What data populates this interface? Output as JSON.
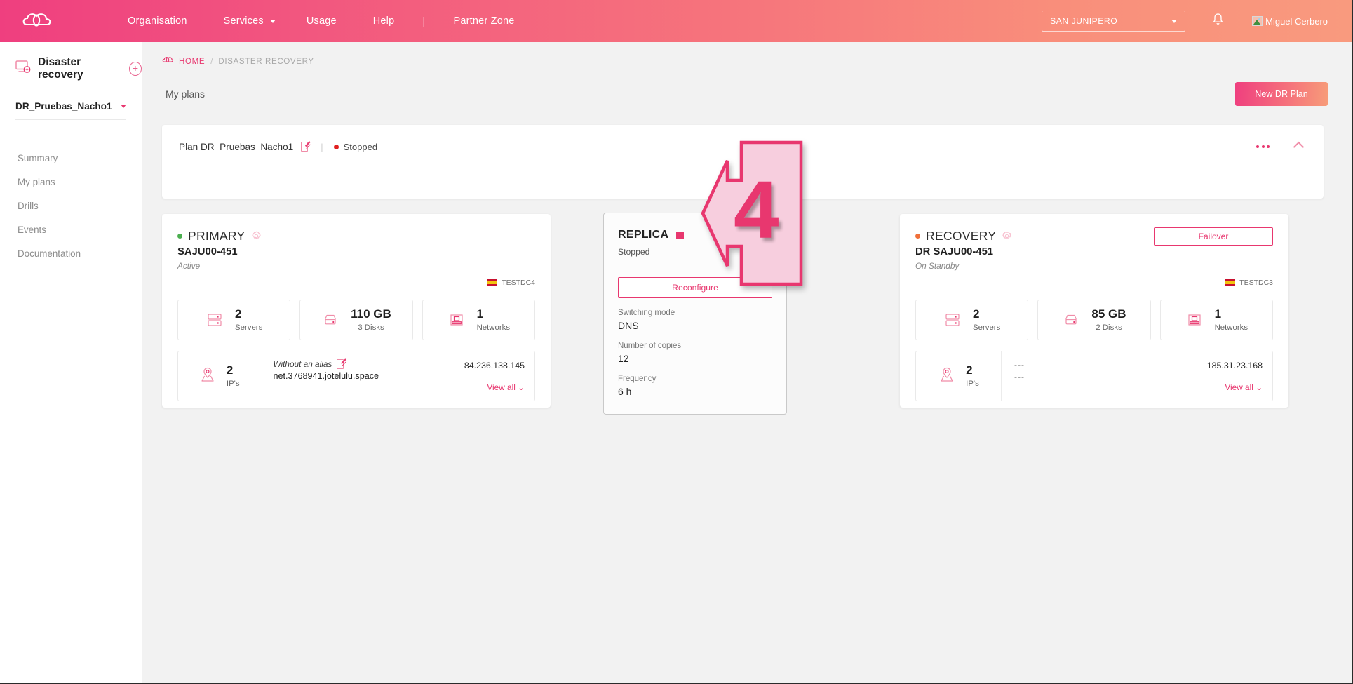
{
  "topnav": {
    "logo_icon": "cloud-logo-icon",
    "links": [
      {
        "label": "Organisation",
        "caret": false
      },
      {
        "label": "Services",
        "caret": true
      },
      {
        "label": "Usage",
        "caret": false
      },
      {
        "label": "Help",
        "caret": false
      }
    ],
    "separator": "|",
    "partner_zone": "Partner Zone",
    "org_selector": "SAN JUNIPERO",
    "bell_icon": "notification-bell-icon",
    "user_name": "Miguel Cerbero"
  },
  "sidebar": {
    "title": "Disaster recovery",
    "title_icon": "disaster-recovery-icon",
    "add_label": "+",
    "plan_selector": "DR_Pruebas_Nacho1",
    "items": [
      {
        "label": "Summary"
      },
      {
        "label": "My plans"
      },
      {
        "label": "Drills"
      },
      {
        "label": "Events"
      },
      {
        "label": "Documentation"
      }
    ]
  },
  "breadcrumb": {
    "home": "HOME",
    "separator": "/",
    "current": "DISASTER RECOVERY"
  },
  "page": {
    "title": "My plans",
    "new_plan_button": "New DR Plan"
  },
  "plan": {
    "title": "Plan DR_Pruebas_Nacho1",
    "divider": "|",
    "status": "Stopped",
    "status_color": "#e02020",
    "more_menu": "•••",
    "collapse": "chevron-up"
  },
  "primary": {
    "role": "PRIMARY",
    "status_dot_color": "#4caf50",
    "host": "SAJU00-451",
    "state": "Active",
    "datacenter": "TESTDC4",
    "stats": [
      {
        "icon": "server-icon",
        "value": "2",
        "label": "Servers"
      },
      {
        "icon": "disk-icon",
        "value": "110 GB",
        "label": "3 Disks"
      },
      {
        "icon": "network-icon",
        "value": "1",
        "label": "Networks"
      }
    ],
    "ip": {
      "icon": "location-pin-icon",
      "count": "2",
      "count_label": "IP's",
      "alias": "Without an alias",
      "alias_edit_icon": "edit-icon",
      "hostname": "net.3768941.jotelulu.space",
      "address": "84.236.138.145",
      "view_all": "View all"
    }
  },
  "replica": {
    "title": "REPLICA",
    "square_color": "#e8376f",
    "state": "Stopped",
    "reconfigure_button": "Reconfigure",
    "fields": [
      {
        "label": "Switching mode",
        "value": "DNS"
      },
      {
        "label": "Number of copies",
        "value": "12"
      },
      {
        "label": "Frequency",
        "value": "6 h"
      }
    ]
  },
  "recovery": {
    "role": "RECOVERY",
    "status_dot_color": "#f0703a",
    "host": "DR SAJU00-451",
    "state": "On Standby",
    "datacenter": "TESTDC3",
    "failover_button": "Failover",
    "stats": [
      {
        "icon": "server-icon",
        "value": "2",
        "label": "Servers"
      },
      {
        "icon": "disk-icon",
        "value": "85 GB",
        "label": "2 Disks"
      },
      {
        "icon": "network-icon",
        "value": "1",
        "label": "Networks"
      }
    ],
    "ip": {
      "icon": "location-pin-icon",
      "count": "2",
      "count_label": "IP's",
      "alias": "---",
      "hostname": "---",
      "address": "185.31.23.168",
      "view_all": "View all"
    }
  },
  "annotation": {
    "number": "4",
    "shape": "left-arrow-callout",
    "fill": "#f7cede",
    "stroke": "#e8376f"
  },
  "theme": {
    "accent": "#e8376f",
    "header_gradient_start": "#ef3f7f",
    "header_gradient_end": "#f99a7e",
    "page_bg": "#f2f2f2"
  }
}
